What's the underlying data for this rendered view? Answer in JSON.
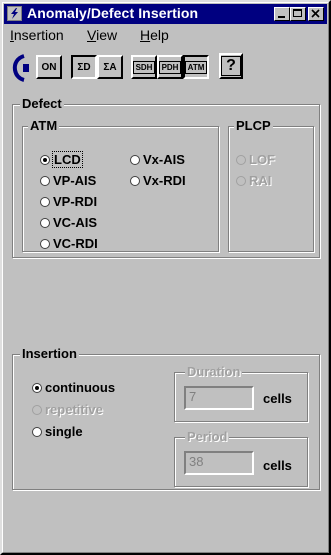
{
  "window": {
    "title": "Anomaly/Defect Insertion"
  },
  "menu": [
    {
      "label": "Insertion",
      "mnemonic_index": 0
    },
    {
      "label": "View",
      "mnemonic_index": 0
    },
    {
      "label": "Help",
      "mnemonic_index": 0
    }
  ],
  "toolbar": {
    "on_label": "ON",
    "defect_label": "ΣD",
    "anomaly_label": "ΣA",
    "sdh_label": "SDH",
    "pdh_label": "PDH",
    "atm_label": "ATM",
    "help_label": "?"
  },
  "defect": {
    "group_label": "Defect",
    "atm": {
      "label": "ATM",
      "options": [
        "LCD",
        "VP-AIS",
        "VP-RDI",
        "VC-AIS",
        "VC-RDI",
        "Vx-AIS",
        "Vx-RDI"
      ],
      "selected": "LCD"
    },
    "plcp": {
      "label": "PLCP",
      "options": [
        "LOF",
        "RAI"
      ]
    }
  },
  "insertion": {
    "label": "Insertion",
    "modes": [
      "continuous",
      "repetitive",
      "single"
    ],
    "selected": "continuous",
    "duration": {
      "label": "Duration",
      "value": "7",
      "unit": "cells"
    },
    "period": {
      "label": "Period",
      "value": "38",
      "unit": "cells"
    }
  },
  "colors": {
    "title_bar": "#000080",
    "face": "#c0c0c0"
  }
}
